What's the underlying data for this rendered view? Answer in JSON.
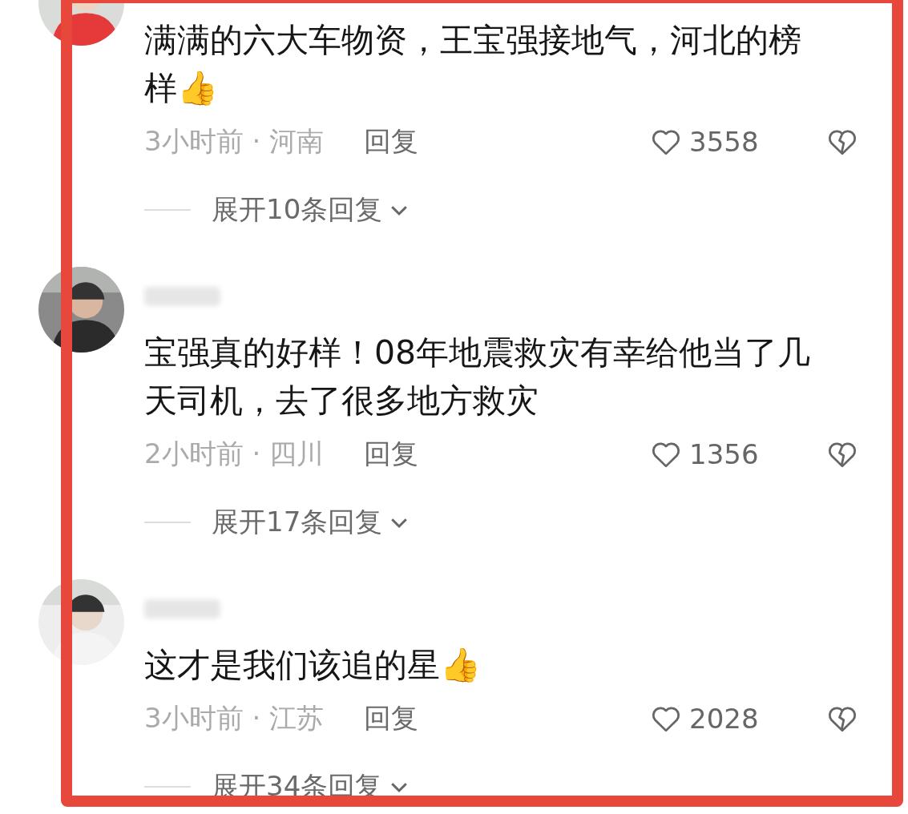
{
  "comments": [
    {
      "name_blurred": false,
      "text": "满满的六大车物资，王宝强接地气，河北的榜样👍",
      "meta": "3小时前 · 河南",
      "reply": "回复",
      "likes": "3558",
      "expand": "展开10条回复"
    },
    {
      "name_blurred": true,
      "text": "宝强真的好样！08年地震救灾有幸给他当了几天司机，去了很多地方救灾",
      "meta": "2小时前 · 四川",
      "reply": "回复",
      "likes": "1356",
      "expand": "展开17条回复"
    },
    {
      "name_blurred": true,
      "text": "这才是我们该追的星👍",
      "meta": "3小时前 · 江苏",
      "reply": "回复",
      "likes": "2028",
      "expand": "展开34条回复"
    }
  ]
}
